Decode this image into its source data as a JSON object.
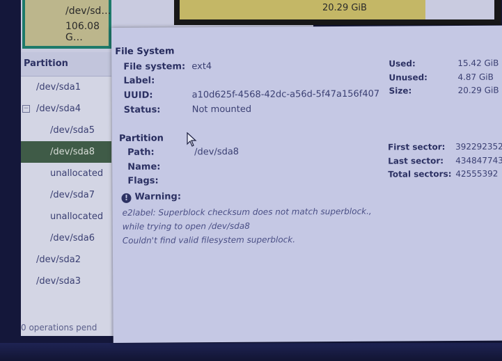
{
  "disk_map": {
    "left_partition": {
      "path": "/dev/sd…",
      "size": "106.08 G…"
    },
    "selected_partition_size": "20.29 GiB",
    "colors": {
      "used": "#c4b766",
      "border": "#1e7a6a",
      "frame": "#181818"
    }
  },
  "partition_tree": {
    "header": "Partition",
    "rows": [
      {
        "label": "/dev/sda1",
        "level": 1,
        "selected": false
      },
      {
        "label": "/dev/sda4",
        "level": 1,
        "selected": false,
        "expander": "−"
      },
      {
        "label": "/dev/sda5",
        "level": 2,
        "selected": false
      },
      {
        "label": "/dev/sda8",
        "level": 2,
        "selected": true
      },
      {
        "label": "unallocated",
        "level": 2,
        "selected": false
      },
      {
        "label": "/dev/sda7",
        "level": 2,
        "selected": false
      },
      {
        "label": "unallocated",
        "level": 2,
        "selected": false
      },
      {
        "label": "/dev/sda6",
        "level": 2,
        "selected": false
      },
      {
        "label": "/dev/sda2",
        "level": 1,
        "selected": false
      },
      {
        "label": "/dev/sda3",
        "level": 1,
        "selected": false
      }
    ],
    "selected_color": "#3f5b47"
  },
  "status_bar": "0 operations pend",
  "info": {
    "file_system": {
      "title": "File System",
      "fs_label": "File system:",
      "fs_value": "ext4",
      "label_label": "Label:",
      "label_value": "",
      "uuid_label": "UUID:",
      "uuid_value": "a10d625f-4568-42dc-a56d-5f47a156f407",
      "status_label": "Status:",
      "status_value": "Not mounted",
      "used_label": "Used:",
      "used_value": "15.42 GiB",
      "unused_label": "Unused:",
      "unused_value": "4.87 GiB",
      "size_label": "Size:",
      "size_value": "20.29 GiB"
    },
    "partition": {
      "title": "Partition",
      "path_label": "Path:",
      "path_value": "/dev/sda8",
      "name_label": "Name:",
      "name_value": "",
      "flags_label": "Flags:",
      "flags_value": "",
      "first_sector_label": "First sector:",
      "first_sector_value": "392292352",
      "last_sector_label": "Last sector:",
      "last_sector_value": "434847743",
      "total_sectors_label": "Total sectors:",
      "total_sectors_value": "42555392"
    },
    "warning": {
      "icon": "!",
      "title": "Warning:",
      "lines": [
        "e2label: Superblock checksum does not match superblock.,",
        "while trying to open /dev/sda8",
        "Couldn't find valid filesystem superblock."
      ]
    }
  }
}
